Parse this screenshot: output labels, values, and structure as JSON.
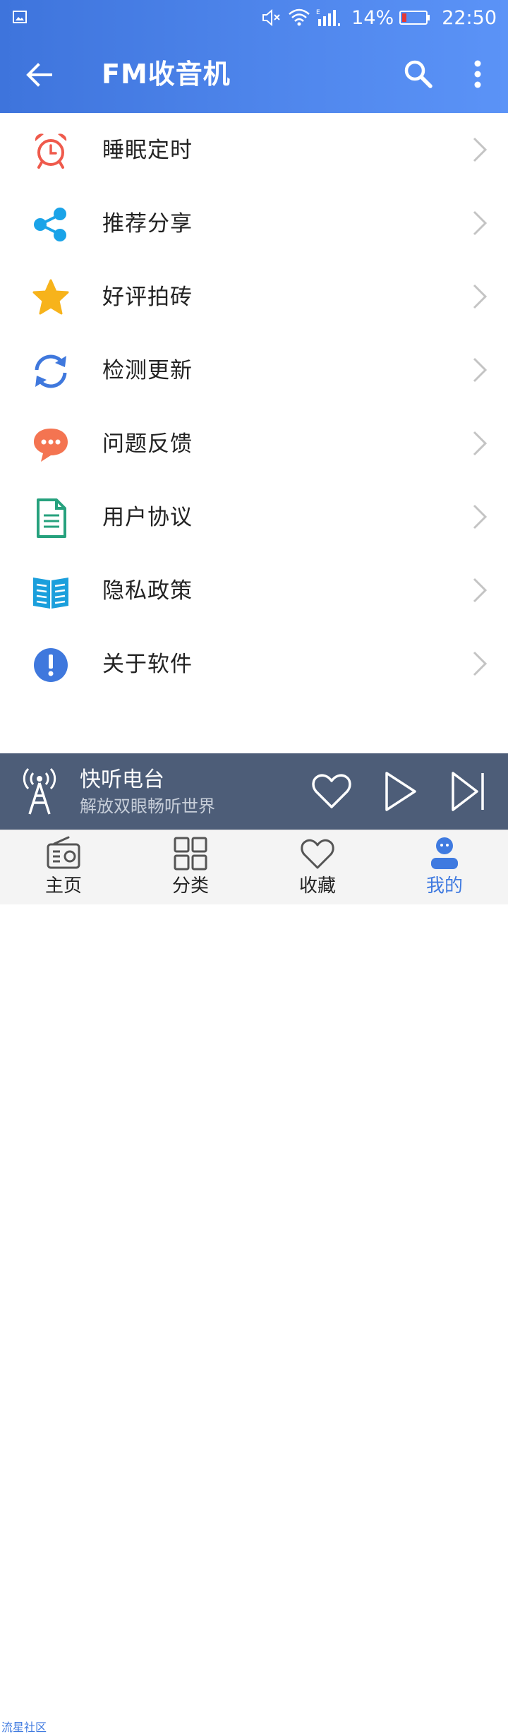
{
  "status": {
    "battery": "14%",
    "time": "22:50",
    "signal_type": "E"
  },
  "toolbar": {
    "title": "FM收音机",
    "back_icon": "back-arrow-icon",
    "search_icon": "search-icon",
    "more_icon": "more-vertical-icon"
  },
  "menu": {
    "items": [
      {
        "label": "睡眠定时",
        "icon": "alarm-clock-icon",
        "color": "#ef5a4c"
      },
      {
        "label": "推荐分享",
        "icon": "share-icon",
        "color": "#1aa3e8"
      },
      {
        "label": "好评拍砖",
        "icon": "star-icon",
        "color": "#f7b31b"
      },
      {
        "label": "检测更新",
        "icon": "refresh-icon",
        "color": "#3f78dd"
      },
      {
        "label": "问题反馈",
        "icon": "chat-bubble-icon",
        "color": "#f47451"
      },
      {
        "label": "用户协议",
        "icon": "document-icon",
        "color": "#26a17d"
      },
      {
        "label": "隐私政策",
        "icon": "open-book-icon",
        "color": "#1b9fdc"
      },
      {
        "label": "关于软件",
        "icon": "info-exclamation-icon",
        "color": "#3f78dd"
      }
    ]
  },
  "player": {
    "title": "快听电台",
    "subtitle": "解放双眼畅听世界"
  },
  "bottom_nav": {
    "items": [
      {
        "label": "主页",
        "icon": "radio-icon"
      },
      {
        "label": "分类",
        "icon": "grid-icon"
      },
      {
        "label": "收藏",
        "icon": "heart-icon"
      },
      {
        "label": "我的",
        "icon": "profile-icon",
        "active": true
      }
    ]
  },
  "watermark": "流星社区",
  "colors": {
    "header_start": "#3e74dc",
    "header_end": "#5b93f7",
    "player_bg": "#4d5d78",
    "active_tab": "#3f7ae0"
  }
}
